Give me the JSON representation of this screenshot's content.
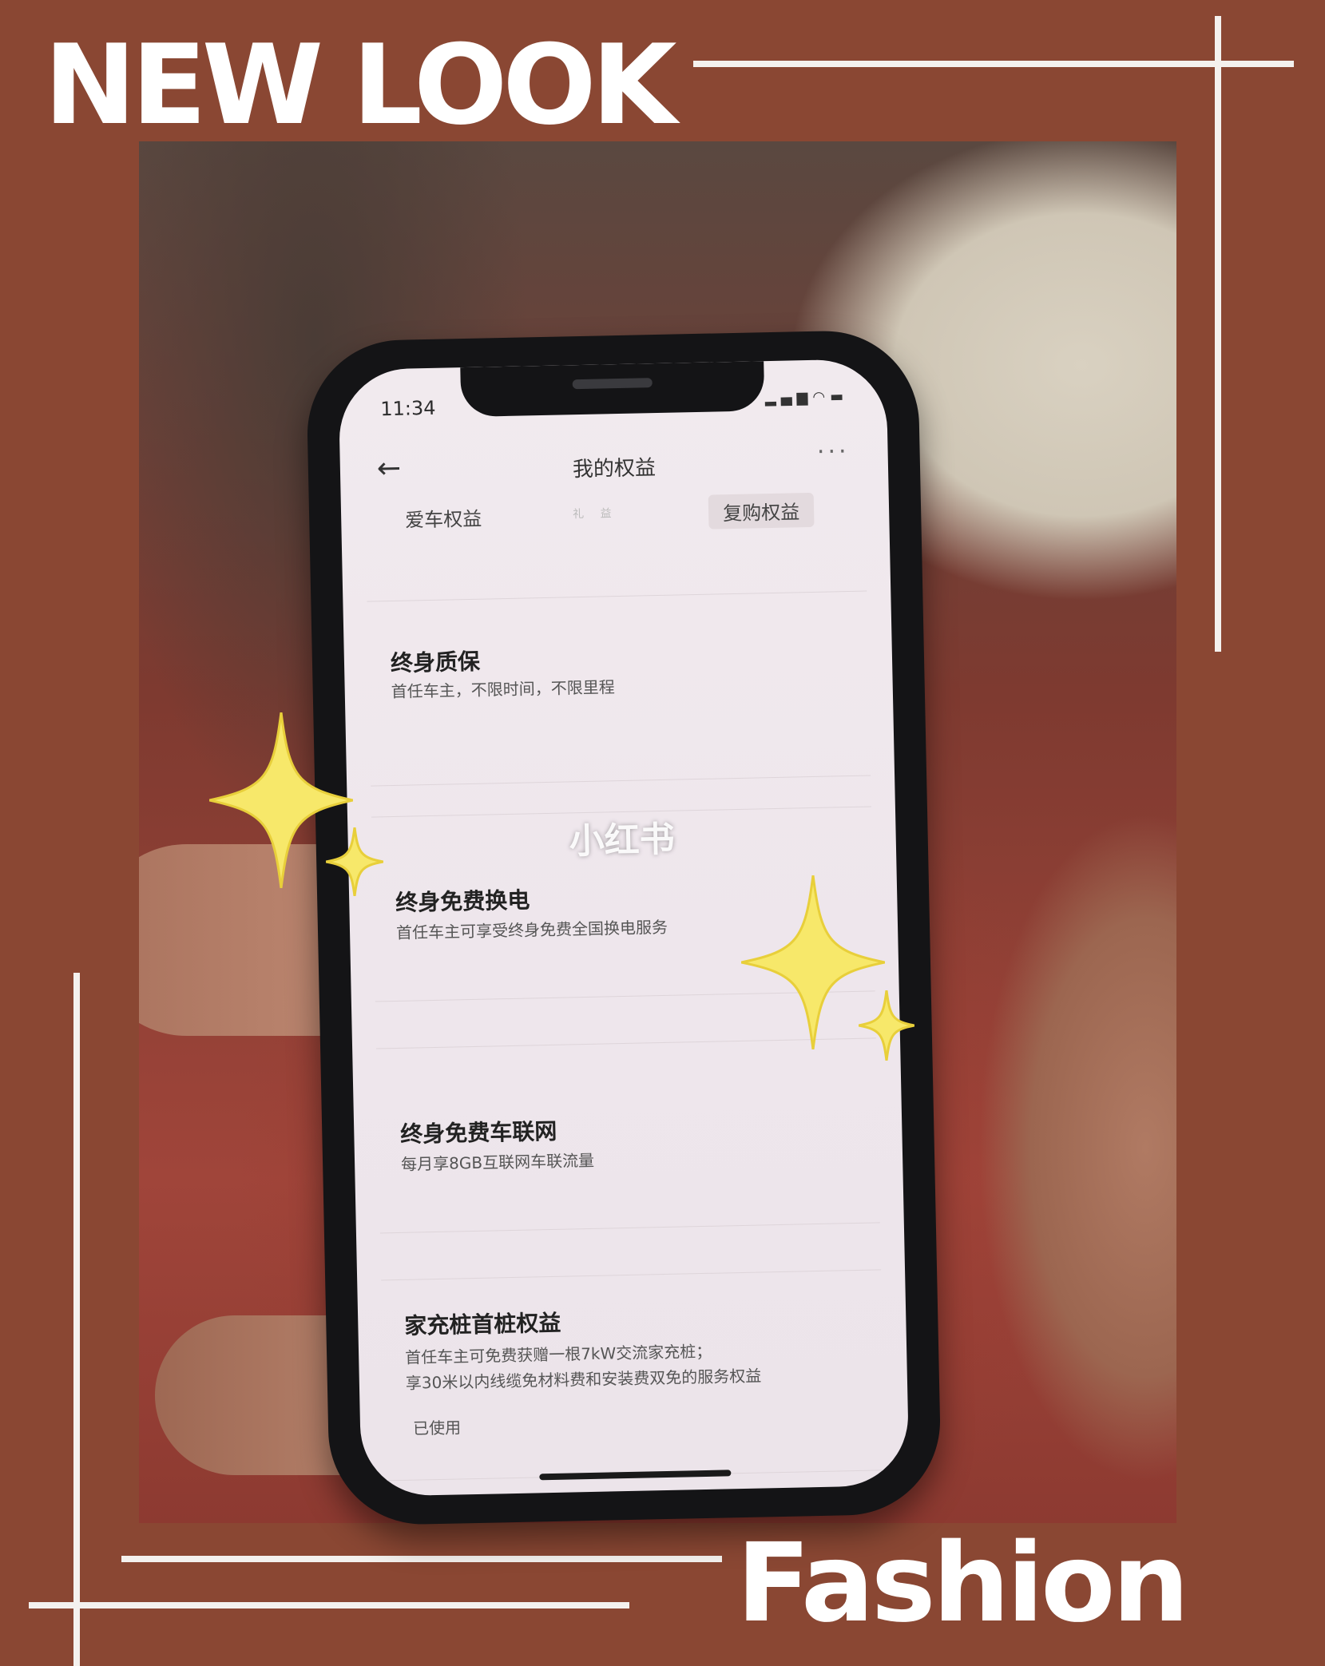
{
  "poster": {
    "headline": "NEW LOOK",
    "footer_word": "Fashion"
  },
  "phone": {
    "status": {
      "time": "11:34"
    },
    "nav": {
      "title": "我的权益"
    },
    "tabs": [
      {
        "label": "爱车权益"
      },
      {
        "label": "礼  益"
      },
      {
        "label": "复购权益"
      }
    ],
    "benefits": [
      {
        "title": "终身质保",
        "desc": "首任车主，不限时间，不限里程"
      },
      {
        "title": "终身免费换电",
        "desc": "首任车主可享受终身免费全国换电服务"
      },
      {
        "title": "终身免费车联网",
        "desc": "每月享8GB互联网车联流量"
      },
      {
        "title": "家充桩首桩权益",
        "desc_line1": "首任车主可免费获赠一根7kW交流家充桩；",
        "desc_line2": "享30米以内线缆免材料费和安装费双免的服务权益",
        "status": "已使用"
      }
    ],
    "watermark": "小红书"
  },
  "colors": {
    "frame_background": "#8a4733",
    "frame_lines": "#f4f1ee",
    "sparkle": "#f7e86a"
  }
}
